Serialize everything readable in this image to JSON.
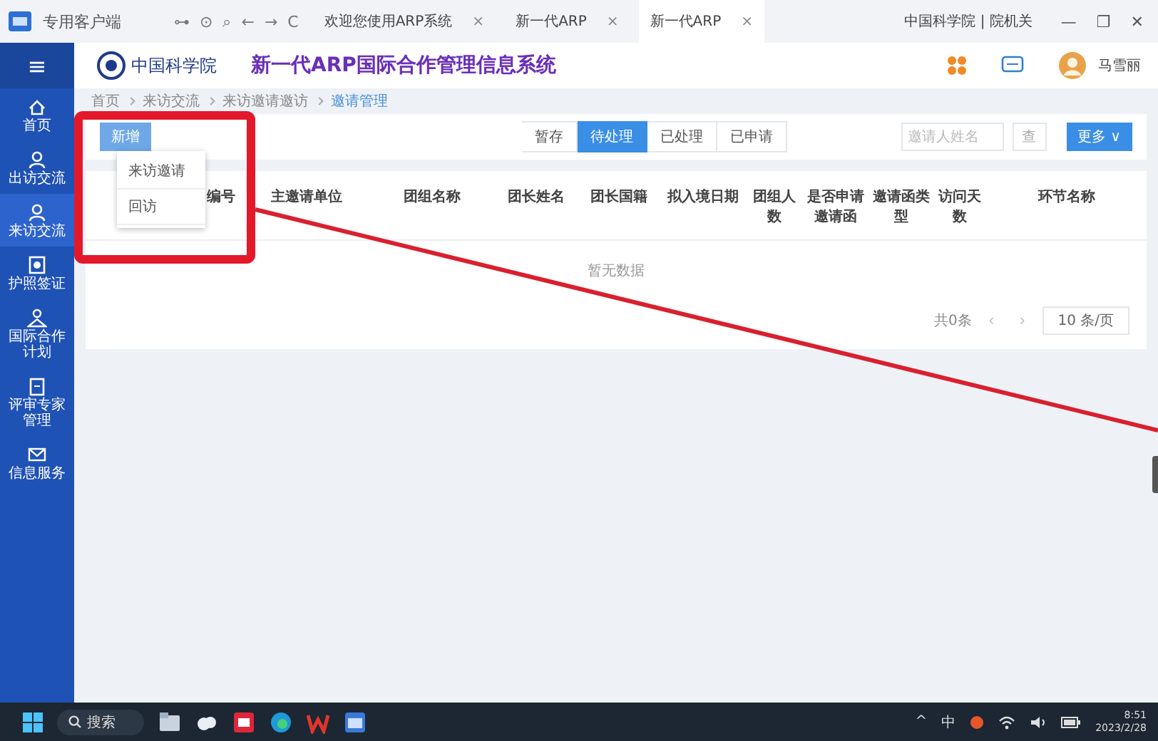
{
  "titlebar": {
    "app_name": "专用客户端",
    "nav": [
      "⊶",
      "⊙",
      "⌕",
      "←",
      "→",
      "C"
    ],
    "tabs": [
      {
        "label": "欢迎您使用ARP系统",
        "close": "×",
        "selected": false
      },
      {
        "label": "新一代ARP",
        "close": "×",
        "selected": false
      },
      {
        "label": "新一代ARP",
        "close": "×",
        "selected": true
      }
    ],
    "org": "中国科学院 | 院机关",
    "controls": [
      "—",
      "❐",
      "✕"
    ]
  },
  "header": {
    "logo_text": "中国科学院",
    "system_title": "新一代ARP国际合作管理信息系统",
    "user": "马雪丽"
  },
  "sidebar": {
    "menu": "≡",
    "items": [
      {
        "label": "首页",
        "selected": false
      },
      {
        "label": "出访交流",
        "selected": false
      },
      {
        "label": "来访交流",
        "selected": true
      },
      {
        "label": "护照签证",
        "selected": false
      },
      {
        "label": "国际合作计划",
        "selected": false
      },
      {
        "label": "评审专家管理",
        "selected": false
      },
      {
        "label": "信息服务",
        "selected": false
      }
    ]
  },
  "breadcrumb": [
    "首页",
    "来访交流",
    "来访邀请邀访",
    "邀请管理"
  ],
  "toolbar": {
    "add_button": "新增",
    "dropdown": [
      "来访邀请",
      "回访"
    ],
    "filters": [
      {
        "label": "暂存",
        "selected": false
      },
      {
        "label": "待处理",
        "selected": true
      },
      {
        "label": "已处理",
        "selected": false
      },
      {
        "label": "已申请",
        "selected": false
      }
    ],
    "search": {
      "placeholder": "邀请人姓名"
    },
    "search_button": "查",
    "more_button": "更多 ∨"
  },
  "table": {
    "columns": [
      "编号",
      "主邀请单位",
      "团组名称",
      "团长姓名",
      "团长国籍",
      "拟入境日期",
      "团组人数",
      "是否申请邀请函",
      "邀请函类型",
      "访问天数",
      "环节名称"
    ],
    "empty": "暂无数据"
  },
  "pagination": {
    "total": "共0条",
    "prev": "‹",
    "next": "›",
    "page_size": "10 条/页"
  },
  "annotations": [
    {
      "kind": "box"
    },
    {
      "kind": "line"
    }
  ],
  "taskbar": {
    "search": "搜索",
    "apps": [
      {
        "kind": "files"
      },
      {
        "kind": "cloud"
      },
      {
        "kind": "red"
      },
      {
        "kind": "edge"
      },
      {
        "kind": "wps"
      },
      {
        "kind": "client"
      }
    ],
    "tray": [
      "^",
      "中"
    ],
    "time": "8:51",
    "date": "2023/2/28"
  }
}
